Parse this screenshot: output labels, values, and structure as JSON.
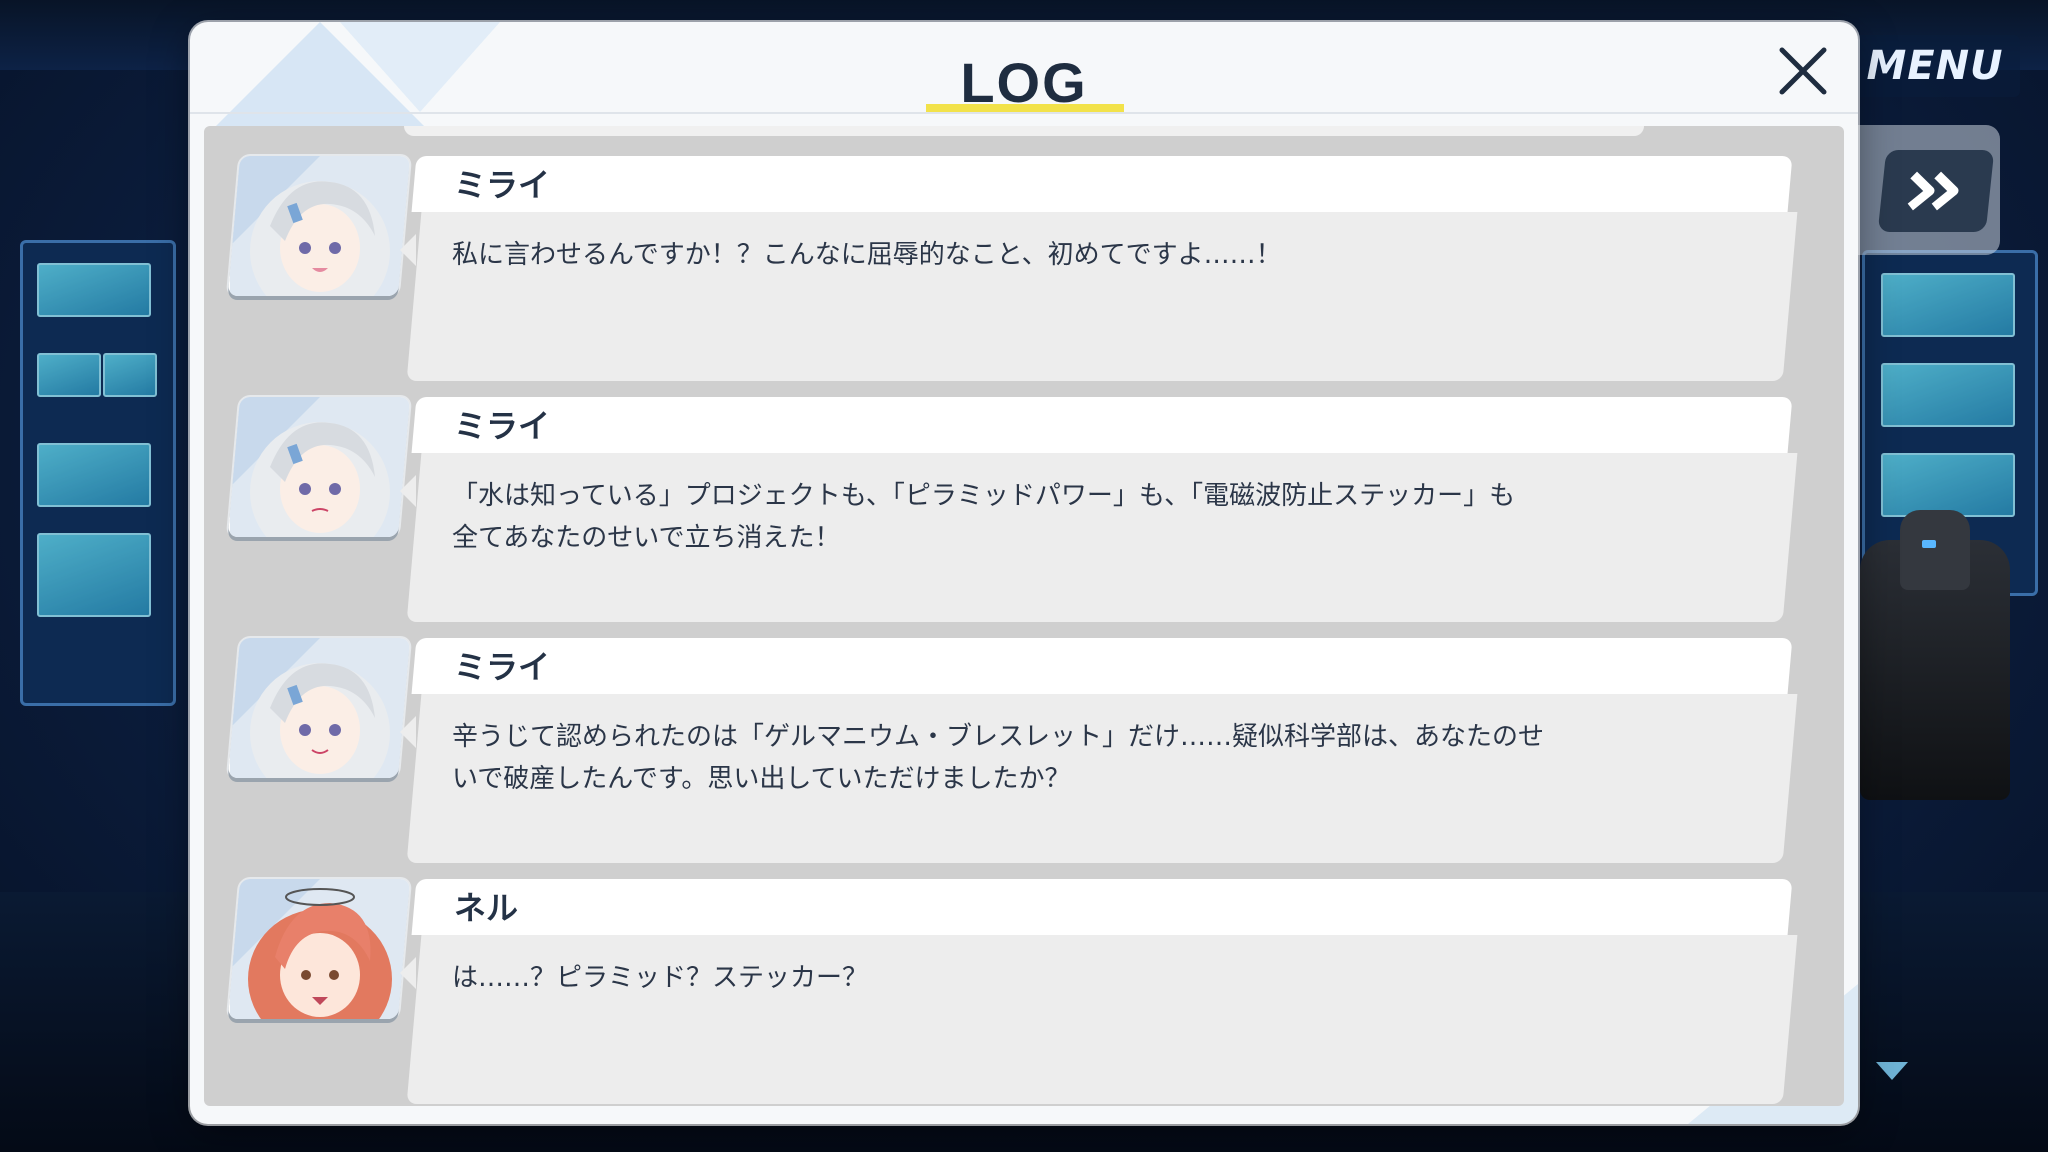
{
  "hud": {
    "menu_label": "MENU",
    "fast_forward_icon": "double-chevron-right-icon"
  },
  "log": {
    "title": "LOG",
    "close_icon": "close-icon",
    "entries": [
      {
        "speaker": "ミライ",
        "text": "私に言わせるんですか！？こんなに屈辱的なこと、初めてですよ……！",
        "portrait": "mirai-portrait"
      },
      {
        "speaker": "ミライ",
        "text": "「水は知っている」プロジェクトも、「ピラミッドパワー」も、「電磁波防止ステッカー」も\n全てあなたのせいで立ち消えた！",
        "portrait": "mirai-portrait"
      },
      {
        "speaker": "ミライ",
        "text": "辛うじて認められたのは「ゲルマニウム・ブレスレット」だけ……疑似科学部は、あなたのせ\nいで破産したんです。思い出していただけましたか？",
        "portrait": "mirai-portrait"
      },
      {
        "speaker": "ネル",
        "text": "は……？ピラミッド？ステッカー？",
        "portrait": "neru-portrait"
      }
    ]
  },
  "colors": {
    "accent_yellow": "#f2e24a",
    "title_text": "#1f2d40",
    "bubble_body": "#ededed",
    "log_background": "#cfcfcf"
  }
}
